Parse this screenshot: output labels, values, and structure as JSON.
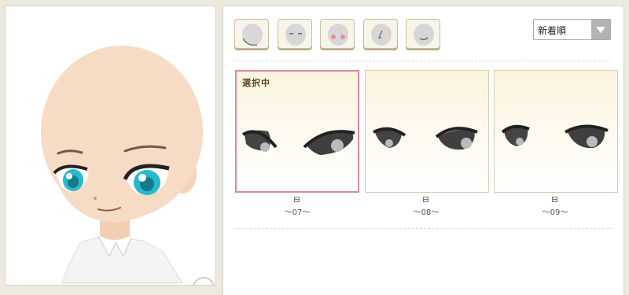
{
  "preview": {
    "skin_color": "#f7dcc5",
    "eye_color": "#2ab8cc"
  },
  "categories": [
    {
      "name": "face-shape"
    },
    {
      "name": "eyes"
    },
    {
      "name": "cheeks"
    },
    {
      "name": "nose"
    },
    {
      "name": "mouth"
    }
  ],
  "sort": {
    "selected": "新着順"
  },
  "items": [
    {
      "badge": "選択中",
      "date": "〜07〜",
      "selected": true
    },
    {
      "badge": "",
      "date": "〜08〜",
      "selected": false
    },
    {
      "badge": "",
      "date": "〜09〜",
      "selected": false
    }
  ],
  "colors": {
    "selected_border": "#e08a9e",
    "accent": "#c9bf9f"
  }
}
